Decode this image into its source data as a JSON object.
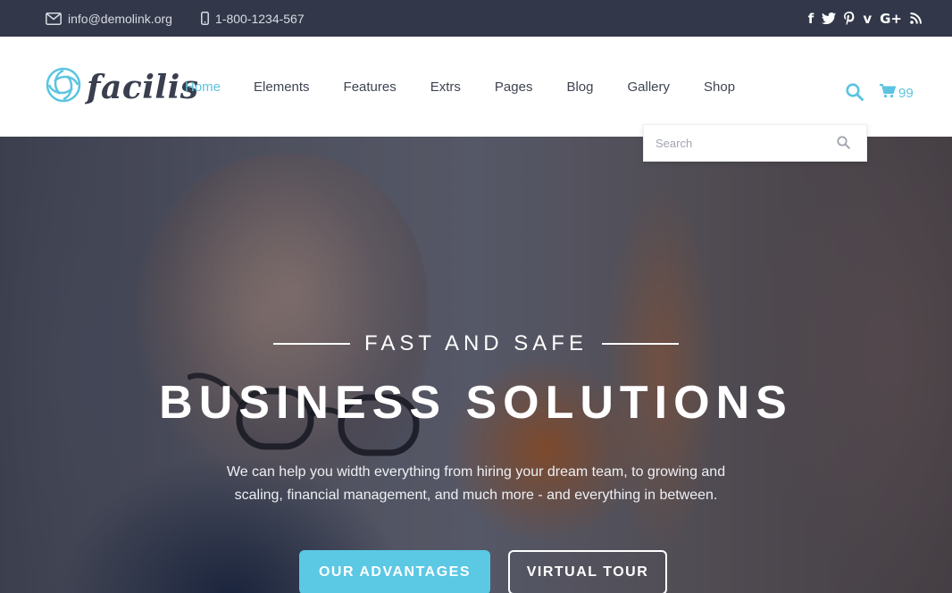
{
  "topbar": {
    "email": "info@demolink.org",
    "phone": "1-800-1234-567",
    "social": [
      "facebook-icon",
      "twitter-icon",
      "pinterest-icon",
      "vimeo-icon",
      "google-plus-icon",
      "rss-icon"
    ],
    "social_glyphs": {
      "facebook": "f",
      "vimeo": "v",
      "google_plus": "G+"
    }
  },
  "header": {
    "logo_text": "facilis",
    "nav": [
      "Home",
      "Elements",
      "Features",
      "Extrs",
      "Pages",
      "Blog",
      "Gallery",
      "Shop"
    ],
    "active_nav": "Home",
    "cart_count": "99"
  },
  "search": {
    "placeholder": "Search"
  },
  "hero": {
    "subtitle": "FAST AND SAFE",
    "title": "BUSINESS SOLUTIONS",
    "description": "We can help you width everything from hiring your dream team, to growing and scaling, financial management, and much more - and everything in between.",
    "primary_button": "OUR ADVANTAGES",
    "secondary_button": "VIRTUAL TOUR"
  },
  "colors": {
    "accent": "#5bc4e0",
    "topbar_bg": "#323849",
    "nav_text": "#3f4452"
  }
}
